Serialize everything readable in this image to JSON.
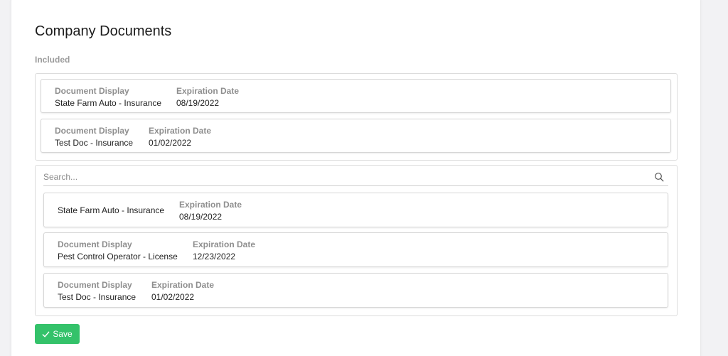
{
  "page": {
    "title": "Company Documents",
    "included_label": "Included"
  },
  "included": [
    {
      "display_label": "Document Display",
      "display": "State Farm Auto - Insurance",
      "expiration_label": "Expiration Date",
      "expiration": "08/19/2022"
    },
    {
      "display_label": "Document Display",
      "display": "Test Doc - Insurance",
      "expiration_label": "Expiration Date",
      "expiration": "01/02/2022"
    }
  ],
  "search": {
    "placeholder": "Search...",
    "value": "",
    "icon": "search-icon"
  },
  "available": [
    {
      "display_label": "",
      "display": "State Farm Auto - Insurance",
      "expiration_label": "Expiration Date",
      "expiration": "08/19/2022"
    },
    {
      "display_label": "Document Display",
      "display": "Pest Control Operator - License",
      "expiration_label": "Expiration Date",
      "expiration": "12/23/2022"
    },
    {
      "display_label": "Document Display",
      "display": "Test Doc - Insurance",
      "expiration_label": "Expiration Date",
      "expiration": "01/02/2022"
    }
  ],
  "actions": {
    "save_label": "Save",
    "save_icon": "check-icon",
    "save_color": "#34c26a"
  }
}
